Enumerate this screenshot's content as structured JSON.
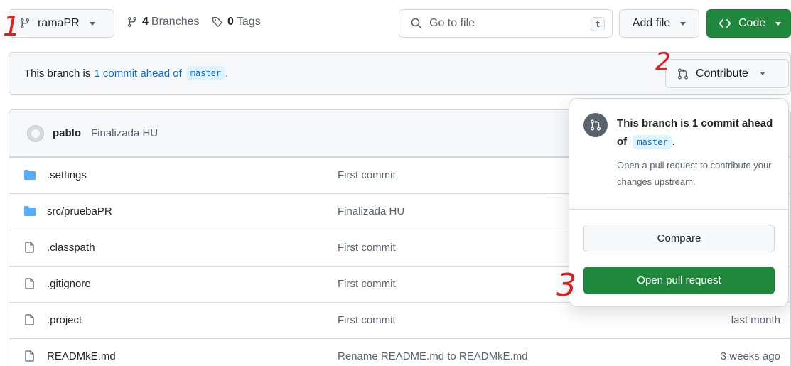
{
  "toolbar": {
    "branch_name": "ramaPR",
    "branches_count": "4",
    "branches_label": "Branches",
    "tags_count": "0",
    "tags_label": "Tags",
    "search_placeholder": "Go to file",
    "search_shortcut": "t",
    "add_file_label": "Add file",
    "code_label": "Code"
  },
  "banner": {
    "prefix": "This branch is",
    "ahead_link": "1 commit ahead of",
    "base_branch": "master",
    "suffix": ".",
    "contribute_label": "Contribute"
  },
  "latest_commit": {
    "author": "pablo",
    "message": "Finalizada HU"
  },
  "files": [
    {
      "type": "folder",
      "name": ".settings",
      "commit": "First commit",
      "age": ""
    },
    {
      "type": "folder",
      "name": "src/pruebaPR",
      "commit": "Finalizada HU",
      "age": ""
    },
    {
      "type": "file",
      "name": ".classpath",
      "commit": "First commit",
      "age": ""
    },
    {
      "type": "file",
      "name": ".gitignore",
      "commit": "First commit",
      "age": ""
    },
    {
      "type": "file",
      "name": ".project",
      "commit": "First commit",
      "age": "last month"
    },
    {
      "type": "file",
      "name": "READMkE.md",
      "commit": "Rename README.md to READMkE.md",
      "age": "3 weeks ago"
    }
  ],
  "popover": {
    "title_prefix": "This branch is 1 commit ahead of",
    "base_branch": "master",
    "title_suffix": ".",
    "description": "Open a pull request to contribute your changes upstream.",
    "compare_label": "Compare",
    "open_pr_label": "Open pull request"
  },
  "annotations": {
    "step1": "1",
    "step2": "2",
    "step3": "3"
  },
  "colors": {
    "accent_green": "#1f883d",
    "link_blue": "#0969da",
    "folder_blue": "#54aeff",
    "annotation_red": "#e01e1e"
  }
}
